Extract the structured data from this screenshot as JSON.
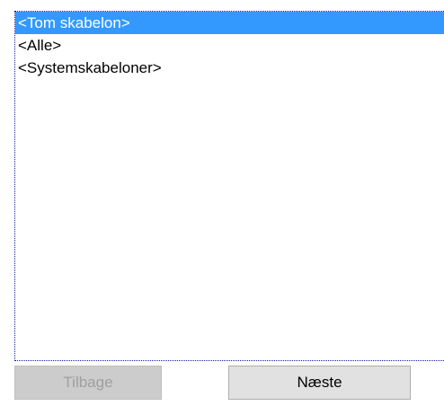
{
  "template_list": {
    "items": [
      {
        "label": "<Tom skabelon>",
        "selected": true
      },
      {
        "label": "<Alle>",
        "selected": false
      },
      {
        "label": "<Systemskabeloner>",
        "selected": false
      }
    ],
    "selected_color": "#3399ff"
  },
  "buttons": {
    "back_label": "Tilbage",
    "back_enabled": false,
    "next_label": "Næste",
    "next_enabled": true
  }
}
